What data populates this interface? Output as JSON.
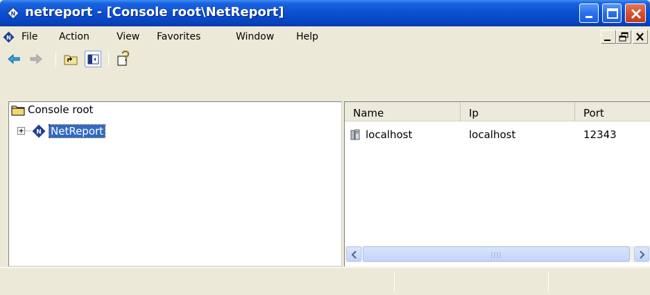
{
  "window": {
    "title": "netreport - [Console root\\NetReport]"
  },
  "menubar": {
    "items": [
      "File",
      "Action",
      "View",
      "Favorites",
      "Window",
      "Help"
    ]
  },
  "toolbar": {
    "icons": [
      "back-arrow-icon",
      "forward-arrow-icon",
      "up-one-level-icon",
      "show-hide-console-tree-icon",
      "help-icon"
    ]
  },
  "tree": {
    "root_label": "Console root",
    "child_label": "NetReport"
  },
  "list": {
    "columns": [
      "Name",
      "Ip",
      "Port"
    ],
    "rows": [
      {
        "name": "localhost",
        "ip": "localhost",
        "port": "12343"
      }
    ]
  },
  "colors": {
    "titlebar": "#0A4FD0",
    "selection": "#316AC5",
    "chrome": "#ECE9D8"
  }
}
